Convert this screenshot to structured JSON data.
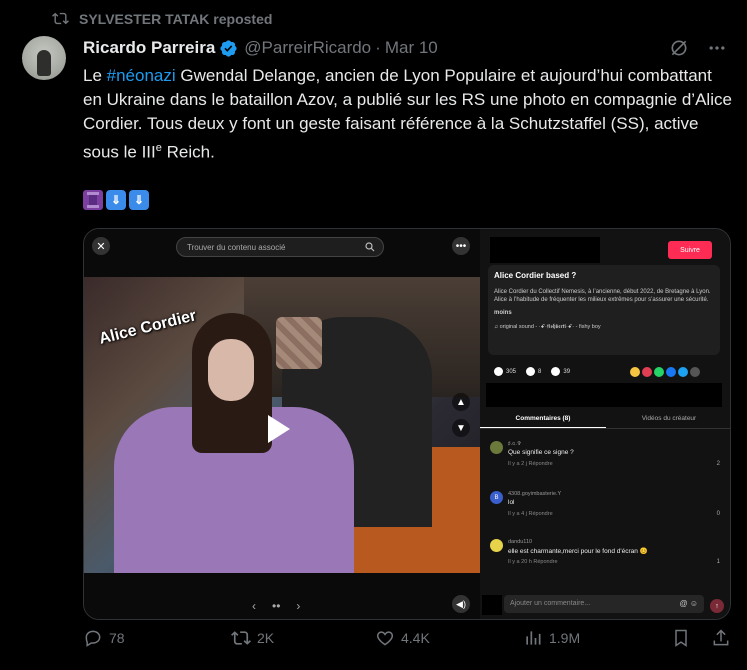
{
  "repost": {
    "text": "SYLVESTER TATAK reposted"
  },
  "author": {
    "name": "Ricardo Parreira",
    "handle": "@ParreirRicardo",
    "separator": "·",
    "date": "Mar 10"
  },
  "post": {
    "prefix": "Le ",
    "hashtag": "#néonazi",
    "text": " Gwendal Delange, ancien de Lyon Populaire et aujourd’hui combattant en Ukraine dans le bataillon Azov, a publié sur les RS une photo en compagnie d’Alice Cordier. Tous deux y font un geste faisant référence à la Schutzstaffel (SS), active sous le III",
    "sup": "e",
    "suffix": " Reich.",
    "emojis": [
      "spool-of-thread",
      "down-arrows",
      "down-arrows"
    ]
  },
  "media": {
    "search_placeholder": "Trouver du contenu associé",
    "photo_label": "Alice Cordier",
    "right": {
      "follow": "Suivre",
      "title": "Alice Cordier based ?",
      "description": "Alice Cordier du Collectif Nemesis, à l’ancienne, début 2022, de Bretagne à Lyon. Alice à l’habitude de fréquenter les milieux extrêmes pour s’assurer une sécurité.",
      "more": "moins",
      "sound": "♫ original sound - ·ꗃ·𝖋𝖎𝖘𝖍𝖇𝖊𝖗𝖙𝖎·ꗃ· - fishy boy",
      "likes": "305",
      "comments": "8",
      "saves": "39",
      "tab_comments": "Commentaires (8)",
      "tab_videos": "Vidéos du créateur",
      "comment_list": [
        {
          "user": "♯.ɢ.✞",
          "text": "Que signifie ce signe ?",
          "meta": "Il y a 2 j    Répondre",
          "likes": "2",
          "color": "#6b7a3a"
        },
        {
          "user": "4308.goyimbasterie.Y",
          "text": "lol",
          "meta": "Il y a 4 j    Répondre",
          "likes": "0",
          "color": "#3a5fcd"
        },
        {
          "user": "dandu110",
          "text": "elle est charmante,merci pour le fond d'écran 😊",
          "meta": "Il y a 20 h    Répondre",
          "likes": "1",
          "color": "#e6d34a"
        }
      ],
      "input_placeholder": "Ajouter un commentaire..."
    }
  },
  "actions": {
    "replies": "78",
    "reposts": "2K",
    "likes": "4.4K",
    "views": "1.9M"
  },
  "colors": {
    "accent": "#1d9bf0",
    "muted": "#71767b",
    "background": "#000000",
    "follow": "#fe2c55"
  }
}
